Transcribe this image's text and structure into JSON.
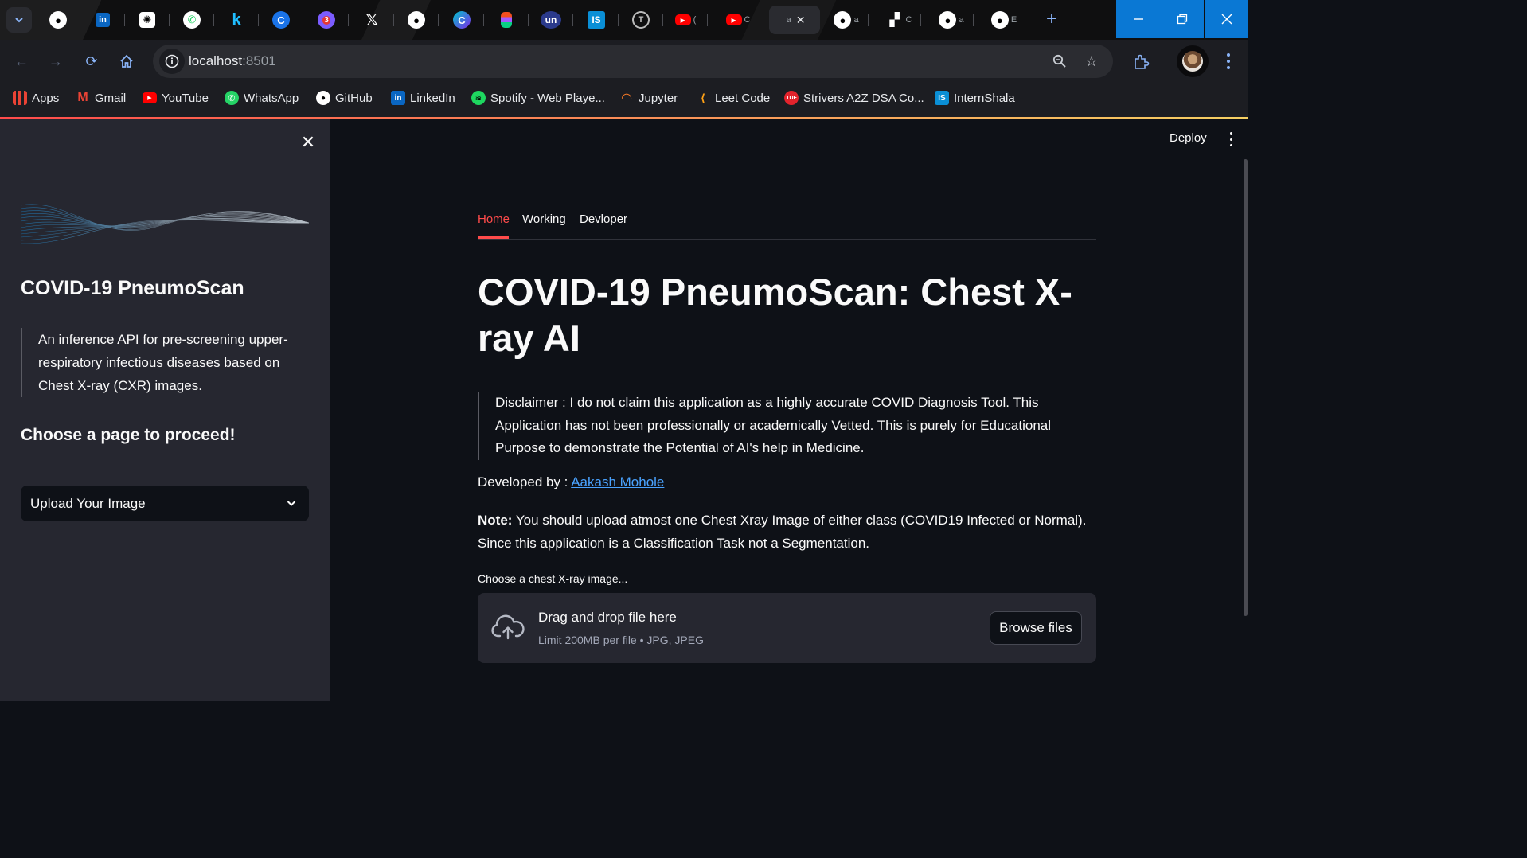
{
  "browser": {
    "tabs": [
      {
        "icon": "github-icon",
        "label": ""
      },
      {
        "icon": "linkedin-icon",
        "label": ""
      },
      {
        "icon": "chatgpt-icon",
        "label": ""
      },
      {
        "icon": "whatsapp-icon",
        "label": ""
      },
      {
        "icon": "kaggle-icon",
        "label": ""
      },
      {
        "icon": "codechef-icon",
        "label": ""
      },
      {
        "icon": "chrome-badge-icon",
        "label": "3"
      },
      {
        "icon": "x-icon",
        "label": ""
      },
      {
        "icon": "github-icon",
        "label": ""
      },
      {
        "icon": "canva-icon",
        "label": ""
      },
      {
        "icon": "figma-icon",
        "label": ""
      },
      {
        "icon": "unstop-icon",
        "label": "un"
      },
      {
        "icon": "internshala-icon",
        "label": "IS"
      },
      {
        "icon": "typing-icon",
        "label": ""
      },
      {
        "icon": "youtube-icon",
        "label": "("
      },
      {
        "icon": "youtube-icon",
        "label": "C"
      },
      {
        "icon": "blank-icon",
        "label": "a"
      },
      {
        "icon": "github-icon",
        "label": "a"
      },
      {
        "icon": "vercel-icon",
        "label": "C"
      },
      {
        "icon": "github-icon",
        "label": "a"
      },
      {
        "icon": "github-icon",
        "label": "E"
      }
    ],
    "url_host": "localhost",
    "url_port": ":8501",
    "bookmarks": [
      "Apps",
      "Gmail",
      "YouTube",
      "WhatsApp",
      "GitHub",
      "LinkedIn",
      "Spotify - Web Playe...",
      "Jupyter",
      "Leet Code",
      "Strivers A2Z DSA Co...",
      "InternShala"
    ]
  },
  "sidebar": {
    "title": "COVID-19 PneumoScan",
    "description": "An inference API for pre-screening upper-respiratory infectious diseases based on Chest X-ray (CXR) images.",
    "prompt": "Choose a page to proceed!",
    "select_value": "Upload Your Image"
  },
  "header": {
    "deploy": "Deploy"
  },
  "main": {
    "tabs": [
      "Home",
      "Working",
      "Devloper"
    ],
    "title": "COVID-19 PneumoScan: Chest X-ray AI",
    "disclaimer": "Disclaimer : I do not claim this application as a highly accurate COVID Diagnosis Tool. This Application has not been professionally or academically Vetted. This is purely for Educational Purpose to demonstrate the Potential of AI's help in Medicine.",
    "developed_by_label": "Developed by : ",
    "developer_name": "Aakash Mohole",
    "note_label": "Note:",
    "note_text": " You should upload atmost one Chest Xray Image of either class (COVID19 Infected or Normal). Since this application is a Classification Task not a Segmentation.",
    "uploader_label": "Choose a chest X-ray image...",
    "dropzone_title": "Drag and drop file here",
    "dropzone_limit": "Limit 200MB per file • JPG, JPEG",
    "browse_label": "Browse files"
  },
  "colors": {
    "accent": "#ff4b4b",
    "link": "#4aa3ff",
    "sidebar_bg": "#262730",
    "main_bg": "#0e1117",
    "window_controls": "#0a78d4"
  }
}
